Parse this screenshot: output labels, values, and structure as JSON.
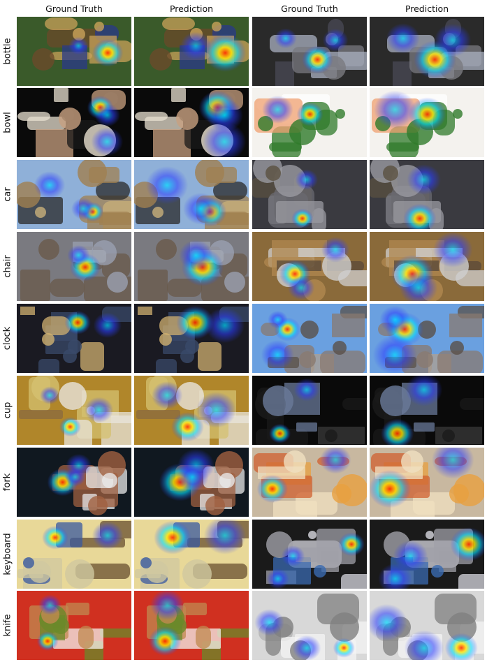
{
  "columns": [
    {
      "header": "Ground Truth"
    },
    {
      "header": "Prediction"
    },
    {
      "header": "Ground Truth"
    },
    {
      "header": "Prediction"
    }
  ],
  "rows": [
    {
      "label": "bottle"
    },
    {
      "label": "bowl"
    },
    {
      "label": "car"
    },
    {
      "label": "chair"
    },
    {
      "label": "clock"
    },
    {
      "label": "cup"
    },
    {
      "label": "fork"
    },
    {
      "label": "keyboard"
    },
    {
      "label": "knife"
    }
  ],
  "scenes": [
    [
      "picnic-food",
      "desk-computer"
    ],
    [
      "plates-table",
      "shrimp-broccoli-plate"
    ],
    [
      "motorcycles-field",
      "office-room"
    ],
    [
      "bedroom-room",
      "office-cubicle"
    ],
    [
      "cluttered-desk",
      "cathedral-towers"
    ],
    [
      "fish-plate",
      "dark-office-desk"
    ],
    [
      "cake-plate",
      "pizza-box"
    ],
    [
      "bedroom-bed",
      "computer-monitor"
    ],
    [
      "burger-plate",
      "bw-table-plates"
    ]
  ],
  "heatmap_colors": {
    "outer": "#2a3cff",
    "mid": "#00e0ff",
    "inner": "#ffe600",
    "core": "#ff2a00"
  }
}
